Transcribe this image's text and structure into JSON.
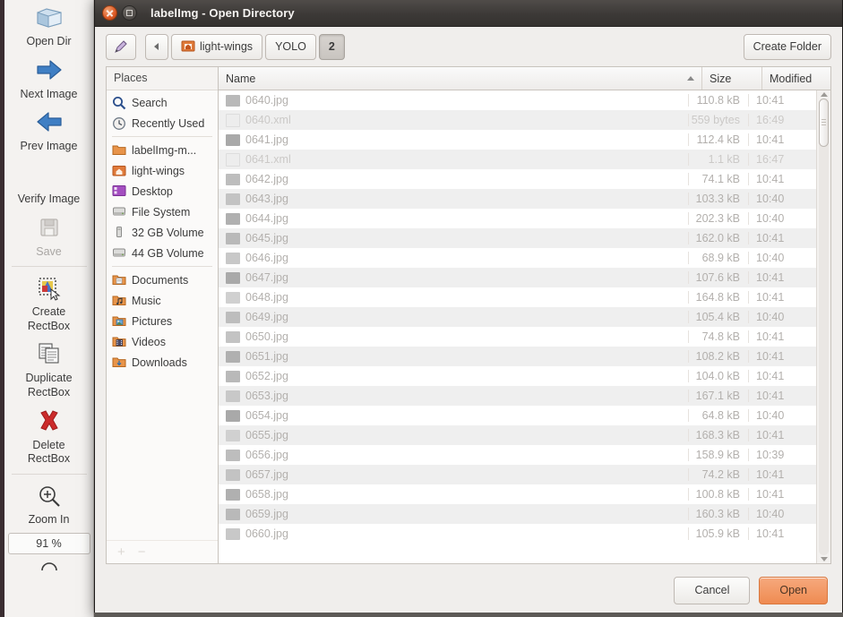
{
  "app": {
    "toolbar_items": [
      {
        "label": "Open Dir",
        "icon": "open-folder-icon",
        "dim": false
      },
      {
        "label": "Next Image",
        "icon": "arrow-right-icon",
        "dim": false
      },
      {
        "label": "Prev Image",
        "icon": "arrow-left-icon",
        "dim": false
      },
      {
        "label": "Verify Image",
        "icon": "verify-icon",
        "dim": false
      },
      {
        "label": "Save",
        "icon": "save-icon",
        "dim": true
      },
      {
        "label": "Create\nRectBox",
        "icon": "create-rectbox-icon",
        "dim": false
      },
      {
        "label": "Duplicate\nRectBox",
        "icon": "duplicate-rectbox-icon",
        "dim": false
      },
      {
        "label": "Delete\nRectBox",
        "icon": "delete-rectbox-icon",
        "dim": false
      },
      {
        "label": "Zoom In",
        "icon": "zoom-in-icon",
        "dim": false
      }
    ],
    "zoom_value": "91 %"
  },
  "dialog": {
    "title": "labelImg - Open Directory",
    "window_buttons": {
      "close": "close-icon",
      "maximize": "maximize-icon"
    },
    "pathbar": {
      "edit_icon": "pencil-icon",
      "back_icon": "chevron-left-icon",
      "crumbs": [
        {
          "label": "light-wings",
          "icon": "folder-home-icon",
          "active": false
        },
        {
          "label": "YOLO",
          "icon": null,
          "active": false
        },
        {
          "label": "2",
          "icon": null,
          "active": true
        }
      ]
    },
    "create_folder_label": "Create Folder",
    "places": {
      "header": "Places",
      "groups": [
        [
          {
            "label": "Search",
            "icon": "search-icon"
          },
          {
            "label": "Recently Used",
            "icon": "recent-icon"
          }
        ],
        [
          {
            "label": "labelImg-m...",
            "icon": "folder-icon"
          },
          {
            "label": "light-wings",
            "icon": "folder-home-icon"
          },
          {
            "label": "Desktop",
            "icon": "desktop-icon"
          },
          {
            "label": "File System",
            "icon": "drive-icon"
          },
          {
            "label": "32 GB Volume",
            "icon": "usb-drive-icon"
          },
          {
            "label": "44 GB Volume",
            "icon": "drive-icon"
          }
        ],
        [
          {
            "label": "Documents",
            "icon": "documents-folder-icon"
          },
          {
            "label": "Music",
            "icon": "music-folder-icon"
          },
          {
            "label": "Pictures",
            "icon": "pictures-folder-icon"
          },
          {
            "label": "Videos",
            "icon": "videos-folder-icon"
          },
          {
            "label": "Downloads",
            "icon": "downloads-folder-icon"
          }
        ]
      ],
      "add_label": "+",
      "remove_label": "−"
    },
    "filelist": {
      "columns": [
        {
          "key": "name",
          "label": "Name",
          "sorted": "ascending"
        },
        {
          "key": "size",
          "label": "Size"
        },
        {
          "key": "modified",
          "label": "Modified"
        }
      ],
      "rows": [
        {
          "name": "0640.jpg",
          "size": "110.8 kB",
          "modified": "10:41",
          "kind": "img"
        },
        {
          "name": "0640.xml",
          "size": "559 bytes",
          "modified": "16:49",
          "kind": "xml"
        },
        {
          "name": "0641.jpg",
          "size": "112.4 kB",
          "modified": "10:41",
          "kind": "img"
        },
        {
          "name": "0641.xml",
          "size": "1.1 kB",
          "modified": "16:47",
          "kind": "xml"
        },
        {
          "name": "0642.jpg",
          "size": "74.1 kB",
          "modified": "10:41",
          "kind": "img"
        },
        {
          "name": "0643.jpg",
          "size": "103.3 kB",
          "modified": "10:40",
          "kind": "img"
        },
        {
          "name": "0644.jpg",
          "size": "202.3 kB",
          "modified": "10:40",
          "kind": "img"
        },
        {
          "name": "0645.jpg",
          "size": "162.0 kB",
          "modified": "10:41",
          "kind": "img"
        },
        {
          "name": "0646.jpg",
          "size": "68.9 kB",
          "modified": "10:40",
          "kind": "img"
        },
        {
          "name": "0647.jpg",
          "size": "107.6 kB",
          "modified": "10:41",
          "kind": "img"
        },
        {
          "name": "0648.jpg",
          "size": "164.8 kB",
          "modified": "10:41",
          "kind": "img"
        },
        {
          "name": "0649.jpg",
          "size": "105.4 kB",
          "modified": "10:40",
          "kind": "img"
        },
        {
          "name": "0650.jpg",
          "size": "74.8 kB",
          "modified": "10:41",
          "kind": "img"
        },
        {
          "name": "0651.jpg",
          "size": "108.2 kB",
          "modified": "10:41",
          "kind": "img"
        },
        {
          "name": "0652.jpg",
          "size": "104.0 kB",
          "modified": "10:41",
          "kind": "img"
        },
        {
          "name": "0653.jpg",
          "size": "167.1 kB",
          "modified": "10:41",
          "kind": "img"
        },
        {
          "name": "0654.jpg",
          "size": "64.8 kB",
          "modified": "10:40",
          "kind": "img"
        },
        {
          "name": "0655.jpg",
          "size": "168.3 kB",
          "modified": "10:41",
          "kind": "img"
        },
        {
          "name": "0656.jpg",
          "size": "158.9 kB",
          "modified": "10:39",
          "kind": "img"
        },
        {
          "name": "0657.jpg",
          "size": "74.2 kB",
          "modified": "10:41",
          "kind": "img"
        },
        {
          "name": "0658.jpg",
          "size": "100.8 kB",
          "modified": "10:41",
          "kind": "img"
        },
        {
          "name": "0659.jpg",
          "size": "160.3 kB",
          "modified": "10:40",
          "kind": "img"
        },
        {
          "name": "0660.jpg",
          "size": "105.9 kB",
          "modified": "10:41",
          "kind": "img"
        }
      ]
    },
    "footer": {
      "cancel_label": "Cancel",
      "open_label": "Open"
    }
  },
  "colors": {
    "accent_orange": "#ef8b52",
    "titlebar": "#3c3937",
    "row_alt": "#efefef"
  }
}
